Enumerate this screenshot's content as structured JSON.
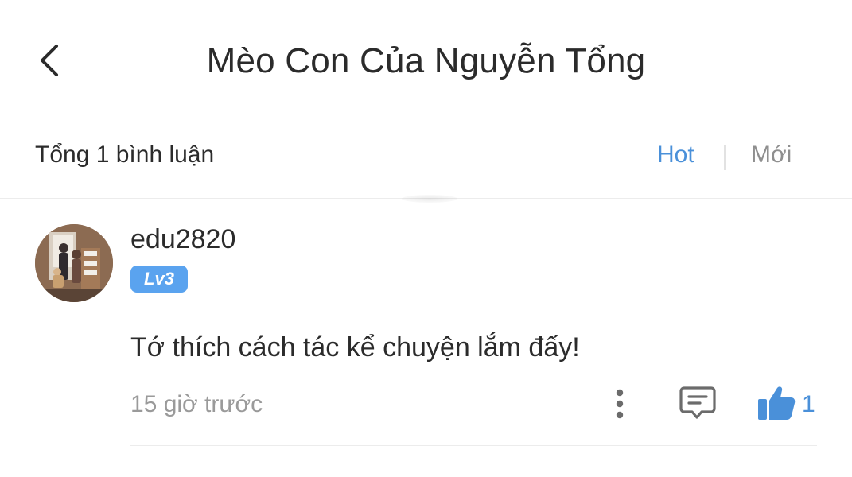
{
  "header": {
    "title": "Mèo Con Của Nguyễn Tổng",
    "back_icon": "chevron-left-icon"
  },
  "comments_bar": {
    "total_label": "Tổng 1 bình luận",
    "sort_hot": "Hot",
    "sort_new": "Mới",
    "active_sort": "Hot"
  },
  "comment": {
    "username": "edu2820",
    "level": "Lv3",
    "text": "Tớ thích cách tác kể chuyện lắm đấy!",
    "time": "15 giờ trước",
    "likes": "1"
  },
  "colors": {
    "accent": "#4a90d9",
    "level_badge": "#5aa3ef",
    "muted_text": "#9a9a9a",
    "divider": "#ececec"
  }
}
